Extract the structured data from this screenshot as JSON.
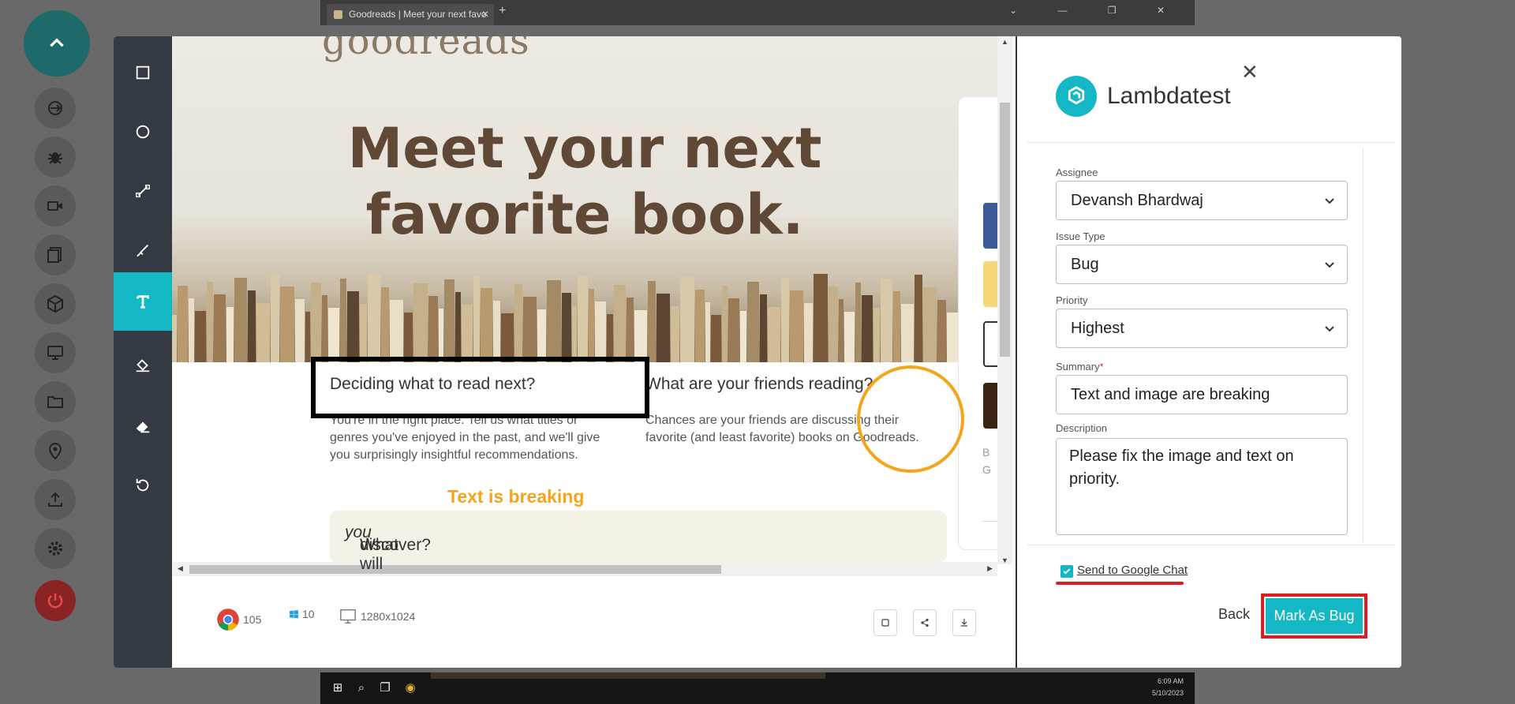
{
  "browser": {
    "tab_title": "Goodreads | Meet your next favo",
    "new_tab": "+",
    "close_tab": "✕",
    "window_controls": "⌄ — ❐ ✕"
  },
  "taskbar": {
    "time": "6:09 AM",
    "date": "5/10/2023"
  },
  "page": {
    "logo": "goodreads",
    "hero_line1": "Meet your next",
    "hero_line2": "favorite book.",
    "col1_heading": "Deciding what to read next?",
    "col1_text": "You're in the right place. Tell us what titles or genres you've enjoyed in the past, and we'll give you surprisingly insightful recommendations.",
    "col2_heading": "What are your friends reading?",
    "col2_text": "Chances are your friends are discussing their favorite (and least favorite) books on Goodreads.",
    "discover": "What will",
    "discover_em": "you",
    "discover_end": "discover?",
    "side_letter1": "B",
    "side_letter2": "G"
  },
  "annotation": {
    "text": "Text is breaking",
    "text_color": "#f4a51c"
  },
  "footer": {
    "browser_version": "105",
    "os_version": "10",
    "resolution": "1280x1024"
  },
  "form": {
    "brand": "Lambdatest",
    "assignee_label": "Assignee",
    "assignee_value": "Devansh Bhardwaj",
    "issue_type_label": "Issue Type",
    "issue_type_value": "Bug",
    "priority_label": "Priority",
    "priority_value": "Highest",
    "summary_label": "Summary",
    "summary_required": "*",
    "summary_value": "Text and image are breaking",
    "description_label": "Description",
    "description_value": "Please fix the image and text on priority.",
    "send_label": "Send to Google Chat",
    "send_checked": true,
    "back_label": "Back",
    "submit_label": "Mark As Bug"
  },
  "colors": {
    "accent": "#14b8c4",
    "toolbar_bg": "#343a41",
    "highlight_red": "#e11b22"
  }
}
